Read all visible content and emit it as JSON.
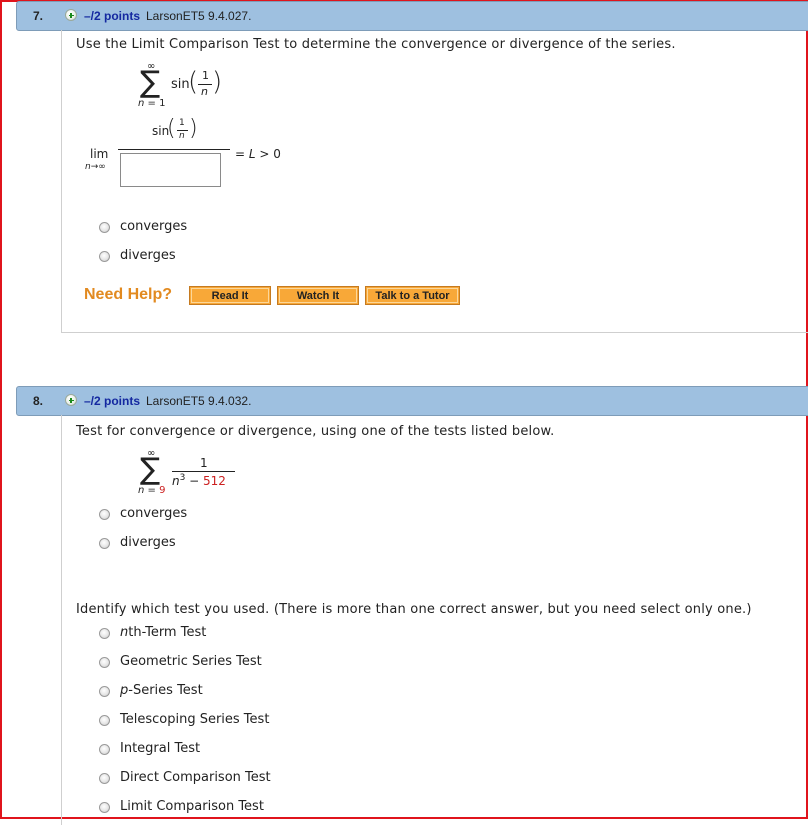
{
  "questions": [
    {
      "number": "7.",
      "points": "–/2 points",
      "source": "LarsonET5 9.4.027.",
      "prompt": "Use the Limit Comparison Test to determine the convergence or divergence of the series.",
      "series": {
        "sum_symbol": "∑",
        "upper": "∞",
        "lower_var": "n",
        "lower_eq": " = 1",
        "term_fn": "sin",
        "term_num": "1",
        "term_den": "n"
      },
      "limit": {
        "lim": "lim",
        "sub": "n→∞",
        "num_fn": "sin",
        "num_num": "1",
        "num_den": "n",
        "answer_value": "",
        "rhs_eq": "= ",
        "rhs_L": "L",
        "rhs_rest": " > 0"
      },
      "options": [
        "converges",
        "diverges"
      ],
      "help": {
        "label": "Need Help?",
        "buttons": [
          "Read It",
          "Watch It",
          "Talk to a Tutor"
        ]
      }
    },
    {
      "number": "8.",
      "points": "–/2 points",
      "source": "LarsonET5 9.4.032.",
      "prompt": "Test for convergence or divergence, using one of the tests listed below.",
      "series": {
        "sum_symbol": "∑",
        "upper": "∞",
        "lower_var": "n",
        "lower_eq": " = ",
        "lower_val": "9",
        "num": "1",
        "den_var": "n",
        "den_exp": "3",
        "den_minus": " − ",
        "den_const": "512"
      },
      "options": [
        "converges",
        "diverges"
      ],
      "test_prompt": "Identify which test you used. (There is more than one correct answer, but you need select only one.)",
      "tests": [
        {
          "italic": "n",
          "rest": "th-Term Test"
        },
        {
          "italic": "",
          "rest": "Geometric Series Test"
        },
        {
          "italic": "p",
          "rest": "-Series Test"
        },
        {
          "italic": "",
          "rest": "Telescoping Series Test"
        },
        {
          "italic": "",
          "rest": "Integral Test"
        },
        {
          "italic": "",
          "rest": "Direct Comparison Test"
        },
        {
          "italic": "",
          "rest": "Limit Comparison Test"
        }
      ]
    }
  ],
  "colors": {
    "header_bg": "#9ec0e0",
    "points_text": "#1428a0",
    "need_help": "#e28a20",
    "help_button": "#f8a838",
    "highlight_red": "#cc2020",
    "frame_border": "#e0141c"
  }
}
